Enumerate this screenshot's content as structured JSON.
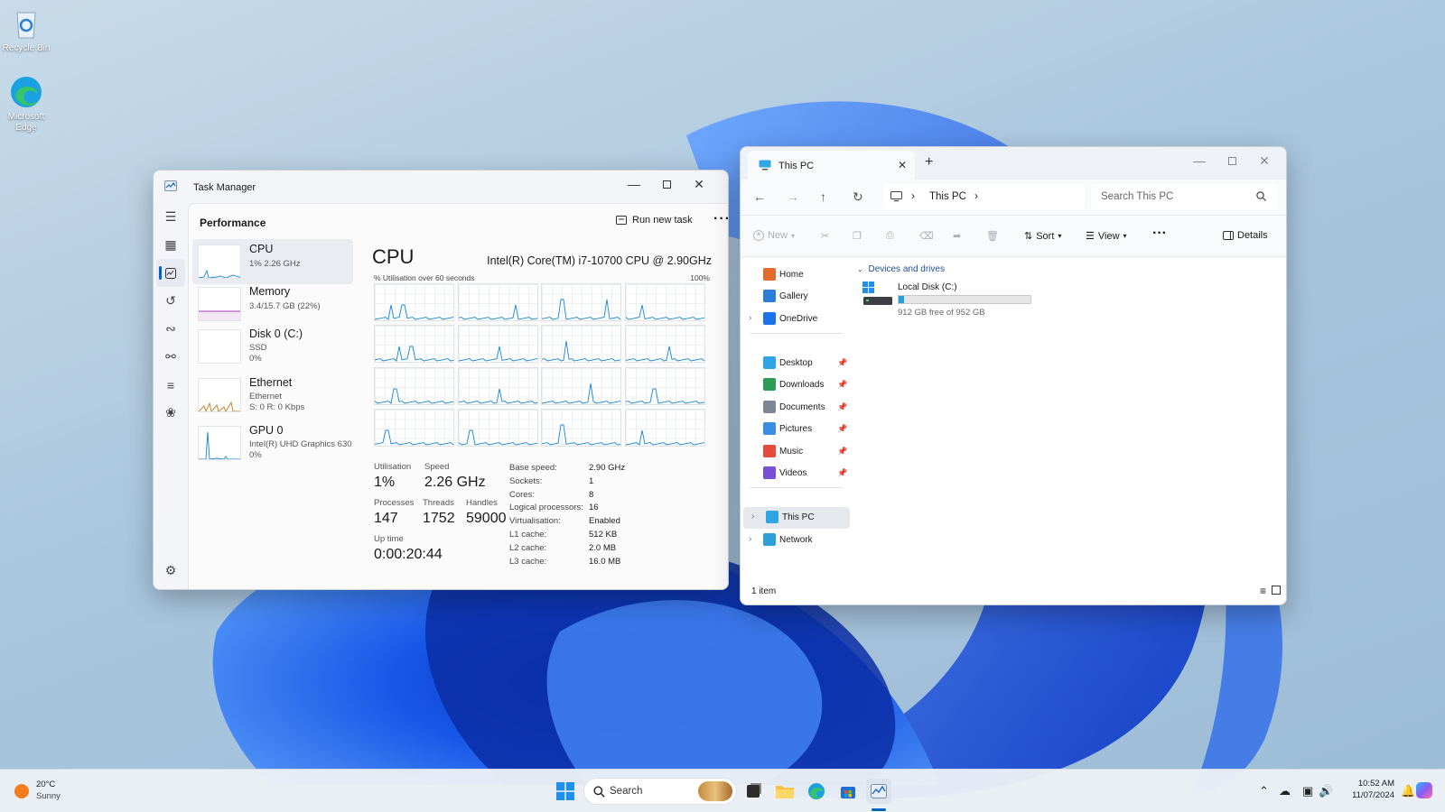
{
  "desktop": {
    "icons": [
      {
        "label": "Recycle Bin"
      },
      {
        "label": "Microsoft Edge"
      }
    ]
  },
  "task_manager": {
    "title": "Task Manager",
    "section": "Performance",
    "run_new_task": "Run new task",
    "devices": [
      {
        "name": "CPU",
        "sub1": "1% 2.26 GHz",
        "sub2": "",
        "sub3": ""
      },
      {
        "name": "Memory",
        "sub1": "3.4/15.7 GB (22%)",
        "sub2": "",
        "sub3": ""
      },
      {
        "name": "Disk 0 (C:)",
        "sub1": "SSD",
        "sub2": "0%",
        "sub3": ""
      },
      {
        "name": "Ethernet",
        "sub1": "Ethernet",
        "sub2": "S: 0 R: 0 Kbps",
        "sub3": ""
      },
      {
        "name": "GPU 0",
        "sub1": "Intel(R) UHD Graphics 630",
        "sub2": "0%",
        "sub3": ""
      }
    ],
    "cpu_heading": "CPU",
    "cpu_model": "Intel(R) Core(TM) i7-10700 CPU @ 2.90GHz",
    "util_caption": "% Utilisation over 60 seconds",
    "util_max": "100%",
    "stats": {
      "utilisation_label": "Utilisation",
      "utilisation": "1%",
      "speed_label": "Speed",
      "speed": "2.26 GHz",
      "processes_label": "Processes",
      "processes": "147",
      "threads_label": "Threads",
      "threads": "1752",
      "handles_label": "Handles",
      "handles": "59000",
      "uptime_label": "Up time",
      "uptime": "0:00:20:44"
    },
    "specs": [
      {
        "k": "Base speed:",
        "v": "2.90 GHz"
      },
      {
        "k": "Sockets:",
        "v": "1"
      },
      {
        "k": "Cores:",
        "v": "8"
      },
      {
        "k": "Logical processors:",
        "v": "16"
      },
      {
        "k": "Virtualisation:",
        "v": "Enabled"
      },
      {
        "k": "L1 cache:",
        "v": "512 KB"
      },
      {
        "k": "L2 cache:",
        "v": "2.0 MB"
      },
      {
        "k": "L3 cache:",
        "v": "16.0 MB"
      }
    ]
  },
  "explorer": {
    "tab_title": "This PC",
    "address": "This PC",
    "search_placeholder": "Search This PC",
    "toolbar": {
      "new": "New",
      "sort": "Sort",
      "view": "View",
      "details": "Details"
    },
    "nav": [
      {
        "label": "Home"
      },
      {
        "label": "Gallery"
      },
      {
        "label": "OneDrive"
      },
      {
        "label": "Desktop"
      },
      {
        "label": "Downloads"
      },
      {
        "label": "Documents"
      },
      {
        "label": "Pictures"
      },
      {
        "label": "Music"
      },
      {
        "label": "Videos"
      },
      {
        "label": "This PC"
      },
      {
        "label": "Network"
      }
    ],
    "group_header": "Devices and drives",
    "drive": {
      "name": "Local Disk (C:)",
      "free_text": "912 GB free of 952 GB",
      "used_fraction": 0.042
    },
    "status": "1 item"
  },
  "taskbar": {
    "weather_temp": "20°C",
    "weather_desc": "Sunny",
    "search_label": "Search",
    "time": "10:52 AM",
    "date": "11/07/2024"
  }
}
